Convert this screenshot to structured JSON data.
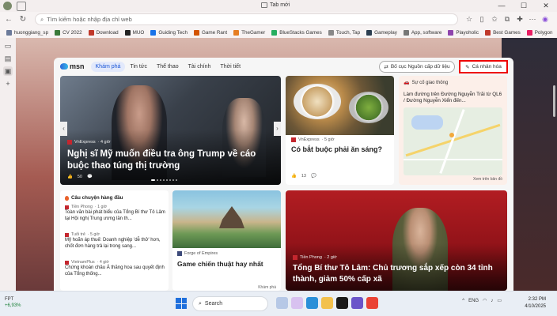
{
  "titlebar": {
    "tab_title": "Tab mới",
    "minimize": "—",
    "maximize": "☐",
    "close": "✕"
  },
  "navbar": {
    "address_placeholder": "Tìm kiếm hoặc nhập địa chỉ web"
  },
  "bookmarks": [
    {
      "label": "huonggiang_sp",
      "color": "#6b7a9a"
    },
    {
      "label": "CV 2022",
      "color": "#3a7a3a"
    },
    {
      "label": "Download",
      "color": "#c0392b"
    },
    {
      "label": "MUO",
      "color": "#222222"
    },
    {
      "label": "Guiding Tech",
      "color": "#1a73e8"
    },
    {
      "label": "Game Rant",
      "color": "#d35400"
    },
    {
      "label": "TheGamer",
      "color": "#e67e22"
    },
    {
      "label": "BlueStacks Games",
      "color": "#27ae60"
    },
    {
      "label": "Touch, Tap",
      "color": "#888888"
    },
    {
      "label": "Gameplay",
      "color": "#2c3e50"
    },
    {
      "label": "App, software",
      "color": "#777777"
    },
    {
      "label": "Playoholic",
      "color": "#8e44ad"
    },
    {
      "label": "Best Games",
      "color": "#c0392b"
    },
    {
      "label": "Polygon",
      "color": "#e91e63"
    }
  ],
  "msn": {
    "logo": "msn",
    "nav": [
      {
        "label": "Khám phá",
        "active": true
      },
      {
        "label": "Tin tức",
        "active": false
      },
      {
        "label": "Thể thao",
        "active": false
      },
      {
        "label": "Tài chính",
        "active": false
      },
      {
        "label": "Thời tiết",
        "active": false
      }
    ],
    "layout_button": "Bố cục Nguồn cấp dữ liệu",
    "personalize_button": "Cá nhân hóa",
    "hero": {
      "source": "VnExpress",
      "time": "· 4 giờ",
      "headline": "Nghị sĩ Mỹ muốn điều tra ông Trump về cáo buộc thao túng thị trường",
      "likes": "50"
    },
    "pho": {
      "source": "VnExpress",
      "time": "· 5 giờ",
      "headline": "Có bắt buộc phải ăn sáng?",
      "likes": "13"
    },
    "traffic": {
      "header": "Sự cố giao thông",
      "description": "Làm đường trên Đường Nguyễn Trãi từ QL6 / Đường Nguyễn Xiển đến...",
      "footer": "Xem trên bản đồ"
    },
    "feed": {
      "header": "Câu chuyện hàng đầu",
      "items": [
        {
          "source": "Tiền Phong",
          "time": "· 1 giờ",
          "title": "Toàn văn bài phát biểu của Tổng Bí thư Tô Lâm tại Hội nghị Trung ương lần th..."
        },
        {
          "source": "Tuổi trẻ",
          "time": "· 5 giờ",
          "title": "Mỹ hoãn áp thuế: Doanh nghiệp 'dễ thở' hơn, chốt đơn hàng trả lại trong sang..."
        },
        {
          "source": "VietnamPlus",
          "time": "· 4 giờ",
          "title": "Chứng khoán châu Á thăng hoa sau quyết định của Tổng thống..."
        }
      ]
    },
    "game": {
      "source": "Forge of Empires",
      "headline": "Game chiến thuật hay nhất",
      "badge": "Khám phá"
    },
    "tolam": {
      "source": "Tiền Phong",
      "time": "· 2 giờ",
      "headline": "Tổng Bí thư Tô Lâm: Chủ trương sắp xếp còn 34 tỉnh thành, giảm 50% cấp xã"
    }
  },
  "taskbar": {
    "stock_name": "FPT",
    "stock_change": "+6,93%",
    "search_label": "Search",
    "language": "ENG",
    "time": "2:32 PM",
    "date": "4/10/2025"
  }
}
